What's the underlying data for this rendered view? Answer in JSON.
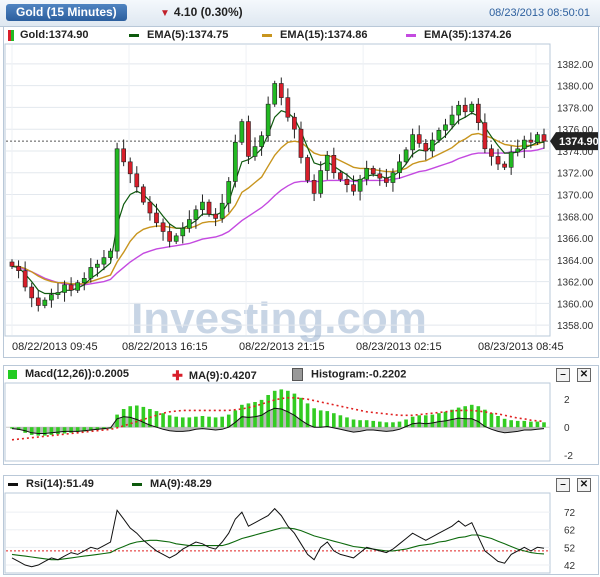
{
  "header": {
    "title": "Gold (15 Minutes)",
    "change": "4.10 (0.30%)",
    "timestamp": "08/23/2013 08:50:01"
  },
  "watermark": "Investing.com",
  "main_panel": {
    "legend": {
      "price": "Gold:1374.90",
      "ema5": "EMA(5):1374.75",
      "ema15": "EMA(15):1374.86",
      "ema35": "EMA(35):1374.26"
    },
    "last_price_label": "1374.90",
    "colors": {
      "up": "#22b922",
      "down": "#d81e2a",
      "ema5": "#0d5a0d",
      "ema15": "#c8951e",
      "ema35": "#c44ae0",
      "ref": "#333333"
    }
  },
  "macd_panel": {
    "legend": {
      "macd": "Macd(12,26)):0.2005",
      "ma": "MA(9):0.4207",
      "hist": "Histogram:-0.2202"
    }
  },
  "rsi_panel": {
    "legend": {
      "rsi": "Rsi(14):51.49",
      "ma": "MA(9):48.29"
    }
  },
  "chart_data": [
    {
      "type": "candlestick",
      "title": "Gold (15 Minutes)",
      "ylim": [
        1357,
        1383
      ],
      "yticks": [
        "1382.00",
        "1380.00",
        "1378.00",
        "1376.00",
        "1374.00",
        "1372.00",
        "1370.00",
        "1368.00",
        "1366.00",
        "1364.00",
        "1362.00",
        "1360.00",
        "1358.00"
      ],
      "xticks": [
        "08/22/2013 09:45",
        "08/22/2013 16:15",
        "08/22/2013 21:15",
        "08/23/2013 02:15",
        "08/23/2013 08:45"
      ],
      "last_price": 1374.9,
      "closes": [
        1363.4,
        1363.0,
        1361.5,
        1360.5,
        1359.8,
        1360.3,
        1360.8,
        1361.0,
        1361.7,
        1361.2,
        1361.9,
        1362.3,
        1363.3,
        1363.6,
        1364.2,
        1364.8,
        1374.2,
        1373.0,
        1371.9,
        1370.7,
        1369.3,
        1368.3,
        1367.4,
        1366.6,
        1365.7,
        1366.2,
        1366.9,
        1367.7,
        1368.6,
        1369.3,
        1368.2,
        1367.8,
        1369.2,
        1371.2,
        1374.8,
        1376.7,
        1373.5,
        1374.4,
        1375.4,
        1378.3,
        1380.2,
        1378.9,
        1377.1,
        1376.0,
        1373.4,
        1371.3,
        1370.1,
        1372.2,
        1373.6,
        1372.0,
        1371.4,
        1370.9,
        1370.3,
        1371.4,
        1372.4,
        1371.9,
        1371.5,
        1371.1,
        1372.0,
        1373.0,
        1374.1,
        1375.5,
        1374.7,
        1374.0,
        1375.0,
        1375.9,
        1376.4,
        1377.3,
        1378.2,
        1377.6,
        1378.3,
        1376.6,
        1374.2,
        1373.5,
        1372.8,
        1372.5,
        1373.9,
        1374.2,
        1375.0,
        1374.8,
        1375.5,
        1374.9
      ],
      "series": [
        {
          "name": "EMA(5)",
          "values": [
            1363.4,
            1363.3,
            1362.7,
            1362.0,
            1361.2,
            1360.9,
            1360.9,
            1360.9,
            1361.2,
            1361.2,
            1361.4,
            1361.7,
            1362.3,
            1362.7,
            1363.2,
            1363.7,
            1367.2,
            1369.1,
            1370.0,
            1370.3,
            1370.0,
            1369.4,
            1368.8,
            1368.0,
            1367.3,
            1366.9,
            1366.9,
            1367.2,
            1367.6,
            1368.2,
            1368.2,
            1368.1,
            1368.4,
            1369.3,
            1371.2,
            1373.0,
            1373.2,
            1373.6,
            1374.2,
            1375.5,
            1377.1,
            1377.7,
            1377.5,
            1377.0,
            1375.8,
            1374.3,
            1372.9,
            1372.7,
            1373.0,
            1372.6,
            1372.2,
            1371.8,
            1371.3,
            1371.3,
            1371.7,
            1371.8,
            1371.7,
            1371.5,
            1371.7,
            1372.1,
            1372.8,
            1373.7,
            1374.1,
            1374.0,
            1374.4,
            1374.9,
            1375.4,
            1376.1,
            1376.8,
            1377.1,
            1377.5,
            1377.2,
            1376.2,
            1375.3,
            1374.5,
            1373.8,
            1373.8,
            1373.9,
            1374.3,
            1374.5,
            1374.8,
            1374.8
          ]
        },
        {
          "name": "EMA(15)",
          "values": [
            1363.4,
            1363.4,
            1363.2,
            1362.9,
            1362.5,
            1362.2,
            1362.0,
            1361.9,
            1361.9,
            1361.8,
            1361.8,
            1361.8,
            1362.0,
            1362.2,
            1362.4,
            1362.6,
            1363.8,
            1364.7,
            1365.7,
            1366.4,
            1366.8,
            1367.0,
            1367.1,
            1367.1,
            1367.0,
            1366.9,
            1366.9,
            1366.9,
            1367.1,
            1367.4,
            1367.5,
            1367.5,
            1367.7,
            1368.2,
            1369.0,
            1370.2,
            1370.6,
            1371.1,
            1371.6,
            1372.6,
            1373.6,
            1374.3,
            1374.8,
            1374.9,
            1374.8,
            1374.3,
            1373.8,
            1373.6,
            1373.6,
            1373.4,
            1373.1,
            1372.8,
            1372.5,
            1372.4,
            1372.4,
            1372.3,
            1372.2,
            1372.1,
            1372.1,
            1372.2,
            1372.4,
            1372.8,
            1373.0,
            1373.1,
            1373.4,
            1373.7,
            1374.0,
            1374.3,
            1374.8,
            1375.1,
            1375.5,
            1375.6,
            1375.4,
            1375.2,
            1374.9,
            1374.6,
            1374.5,
            1374.4,
            1374.5,
            1374.5,
            1374.6,
            1374.9
          ]
        },
        {
          "name": "EMA(35)",
          "values": [
            1363.4,
            1363.3,
            1363.1,
            1362.9,
            1362.6,
            1362.3,
            1362.1,
            1361.9,
            1361.8,
            1361.7,
            1361.7,
            1361.7,
            1361.8,
            1361.9,
            1362.0,
            1362.2,
            1362.8,
            1363.3,
            1363.8,
            1364.2,
            1364.6,
            1364.8,
            1365.0,
            1365.1,
            1365.2,
            1365.3,
            1365.4,
            1365.5,
            1365.7,
            1365.9,
            1366.0,
            1366.1,
            1366.3,
            1366.6,
            1367.1,
            1367.6,
            1368.0,
            1368.4,
            1368.8,
            1369.3,
            1369.9,
            1370.4,
            1370.8,
            1371.1,
            1371.2,
            1371.2,
            1371.2,
            1371.2,
            1371.3,
            1371.3,
            1371.3,
            1371.3,
            1371.2,
            1371.2,
            1371.3,
            1371.3,
            1371.3,
            1371.3,
            1371.4,
            1371.5,
            1371.7,
            1371.9,
            1372.1,
            1372.2,
            1372.4,
            1372.6,
            1372.8,
            1373.0,
            1373.3,
            1373.5,
            1373.7,
            1373.8,
            1373.8,
            1373.8,
            1373.8,
            1373.8,
            1373.9,
            1373.9,
            1374.0,
            1374.0,
            1374.1,
            1374.26
          ]
        }
      ]
    },
    {
      "type": "bar",
      "title": "Macd(12,26))",
      "ylim": [
        -2.2,
        2.8
      ],
      "yticks": [
        "2",
        "0",
        "-2"
      ],
      "series": [
        {
          "name": "Histogram",
          "values": [
            -0.1,
            -0.2,
            -0.4,
            -0.55,
            -0.6,
            -0.6,
            -0.55,
            -0.5,
            -0.45,
            -0.4,
            -0.35,
            -0.3,
            -0.25,
            -0.2,
            -0.15,
            -0.1,
            0.9,
            1.3,
            1.5,
            1.55,
            1.45,
            1.3,
            1.15,
            1.0,
            0.85,
            0.75,
            0.7,
            0.7,
            0.75,
            0.8,
            0.75,
            0.7,
            0.75,
            0.9,
            1.2,
            1.6,
            1.7,
            1.8,
            1.95,
            2.3,
            2.6,
            2.7,
            2.6,
            2.4,
            2.1,
            1.7,
            1.35,
            1.2,
            1.15,
            1.0,
            0.85,
            0.7,
            0.55,
            0.5,
            0.5,
            0.45,
            0.4,
            0.35,
            0.35,
            0.4,
            0.55,
            0.75,
            0.85,
            0.85,
            0.9,
            1.0,
            1.1,
            1.25,
            1.4,
            1.5,
            1.6,
            1.5,
            1.25,
            1.0,
            0.8,
            0.6,
            0.5,
            0.45,
            0.45,
            0.4,
            0.4,
            0.35
          ]
        },
        {
          "name": "MACD",
          "values": [
            -0.1,
            -0.15,
            -0.25,
            -0.4,
            -0.45,
            -0.45,
            -0.4,
            -0.35,
            -0.3,
            -0.3,
            -0.3,
            -0.25,
            -0.2,
            -0.15,
            -0.1,
            -0.05,
            0.6,
            0.75,
            0.7,
            0.55,
            0.35,
            0.15,
            0.0,
            -0.15,
            -0.25,
            -0.3,
            -0.3,
            -0.25,
            -0.15,
            -0.1,
            -0.15,
            -0.2,
            -0.15,
            0.0,
            0.35,
            0.75,
            0.7,
            0.75,
            0.85,
            1.15,
            1.35,
            1.3,
            1.1,
            0.85,
            0.5,
            0.2,
            0.0,
            0.0,
            0.05,
            -0.05,
            -0.15,
            -0.25,
            -0.35,
            -0.3,
            -0.2,
            -0.2,
            -0.25,
            -0.3,
            -0.25,
            -0.15,
            0.05,
            0.25,
            0.3,
            0.25,
            0.3,
            0.4,
            0.45,
            0.55,
            0.65,
            0.6,
            0.6,
            0.4,
            0.05,
            -0.15,
            -0.3,
            -0.4,
            -0.35,
            -0.3,
            -0.2,
            -0.2,
            -0.15,
            -0.1
          ]
        },
        {
          "name": "MA(9)",
          "values": [
            -0.9,
            -0.85,
            -0.8,
            -0.75,
            -0.7,
            -0.65,
            -0.6,
            -0.55,
            -0.5,
            -0.45,
            -0.4,
            -0.35,
            -0.3,
            -0.25,
            -0.2,
            -0.15,
            -0.05,
            0.1,
            0.25,
            0.4,
            0.55,
            0.7,
            0.85,
            1.0,
            1.1,
            1.15,
            1.2,
            1.2,
            1.2,
            1.2,
            1.2,
            1.2,
            1.2,
            1.2,
            1.25,
            1.3,
            1.4,
            1.5,
            1.65,
            1.8,
            1.95,
            2.05,
            2.1,
            2.1,
            2.05,
            2.0,
            1.9,
            1.8,
            1.7,
            1.6,
            1.5,
            1.4,
            1.3,
            1.2,
            1.1,
            1.05,
            1.0,
            0.95,
            0.9,
            0.85,
            0.85,
            0.85,
            0.9,
            0.95,
            1.0,
            1.05,
            1.1,
            1.15,
            1.2,
            1.2,
            1.2,
            1.15,
            1.1,
            1.0,
            0.95,
            0.85,
            0.75,
            0.65,
            0.6,
            0.5,
            0.45,
            0.42
          ]
        }
      ]
    },
    {
      "type": "line",
      "title": "Rsi(14)",
      "ylim": [
        38,
        80
      ],
      "yticks": [
        "72",
        "62",
        "52",
        "42"
      ],
      "series": [
        {
          "name": "Rsi(14)",
          "values": [
            46,
            44,
            42,
            41,
            42,
            44,
            46,
            45,
            47,
            49,
            48,
            50,
            52,
            51,
            53,
            55,
            73,
            68,
            63,
            60,
            56,
            53,
            50,
            48,
            46,
            48,
            51,
            53,
            55,
            54,
            52,
            51,
            55,
            60,
            68,
            72,
            64,
            66,
            68,
            70,
            74,
            70,
            64,
            60,
            54,
            48,
            45,
            52,
            55,
            50,
            48,
            47,
            46,
            49,
            52,
            51,
            50,
            49,
            51,
            54,
            57,
            60,
            58,
            56,
            58,
            60,
            62,
            64,
            67,
            64,
            66,
            58,
            50,
            47,
            44,
            43,
            48,
            50,
            52,
            50,
            52,
            51.49
          ]
        },
        {
          "name": "MA(9)",
          "values": [
            48,
            47.5,
            47,
            46.5,
            46,
            45.5,
            45,
            45,
            45.5,
            46,
            46.5,
            47,
            47.5,
            48,
            48.5,
            49,
            51,
            52.5,
            54,
            55,
            55.5,
            56,
            56,
            55.5,
            55,
            54,
            53.5,
            53,
            53,
            53,
            53,
            53,
            53,
            54,
            55.5,
            57,
            58,
            59,
            60,
            61,
            62,
            63,
            63,
            62.5,
            61.5,
            60,
            58.5,
            57.5,
            56.5,
            55.5,
            54.5,
            53.5,
            52.5,
            52,
            51.5,
            51,
            50.5,
            50,
            50,
            50.5,
            51,
            52,
            53,
            53.5,
            54,
            55,
            55.5,
            56.5,
            57.5,
            58,
            59,
            59,
            58,
            57,
            55.5,
            54,
            52.5,
            51,
            50,
            49,
            48.5,
            48.29
          ]
        },
        {
          "name": "Reference",
          "values": [
            50,
            50
          ]
        }
      ]
    }
  ]
}
